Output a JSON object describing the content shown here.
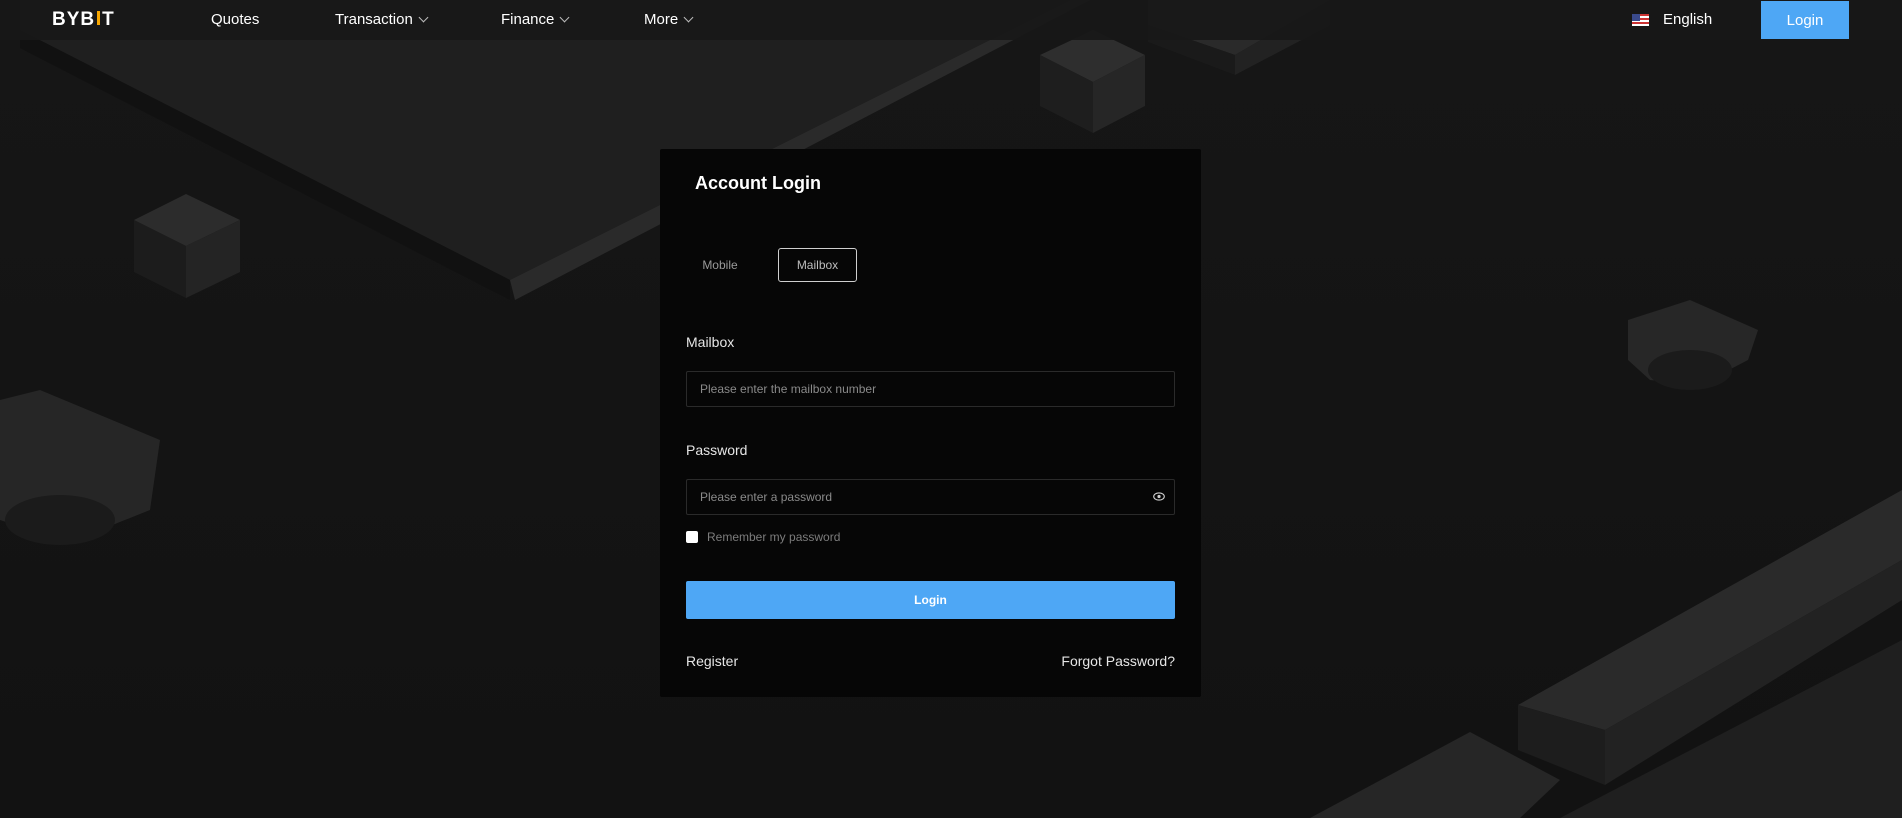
{
  "brand": {
    "logo_left": "BYB",
    "logo_right": "T",
    "accent": "#f7a600"
  },
  "nav": {
    "items": [
      {
        "label": "Quotes",
        "has_dropdown": false
      },
      {
        "label": "Transaction",
        "has_dropdown": true
      },
      {
        "label": "Finance",
        "has_dropdown": true
      },
      {
        "label": "More",
        "has_dropdown": true
      }
    ],
    "language": "English",
    "language_icon": "us-flag-icon",
    "login_label": "Login"
  },
  "login": {
    "title": "Account Login",
    "tabs": [
      {
        "label": "Mobile",
        "active": false
      },
      {
        "label": "Mailbox",
        "active": true
      }
    ],
    "mailbox_label": "Mailbox",
    "mailbox_placeholder": "Please enter the mailbox number",
    "mailbox_value": "",
    "password_label": "Password",
    "password_placeholder": "Please enter a password",
    "password_value": "",
    "password_icon": "eye-icon",
    "remember_label": "Remember my password",
    "remember_checked": false,
    "submit_label": "Login",
    "register_label": "Register",
    "forgot_label": "Forgot Password?"
  },
  "colors": {
    "primary": "#4ea7f5",
    "background": "#141414",
    "card": "#060606"
  }
}
